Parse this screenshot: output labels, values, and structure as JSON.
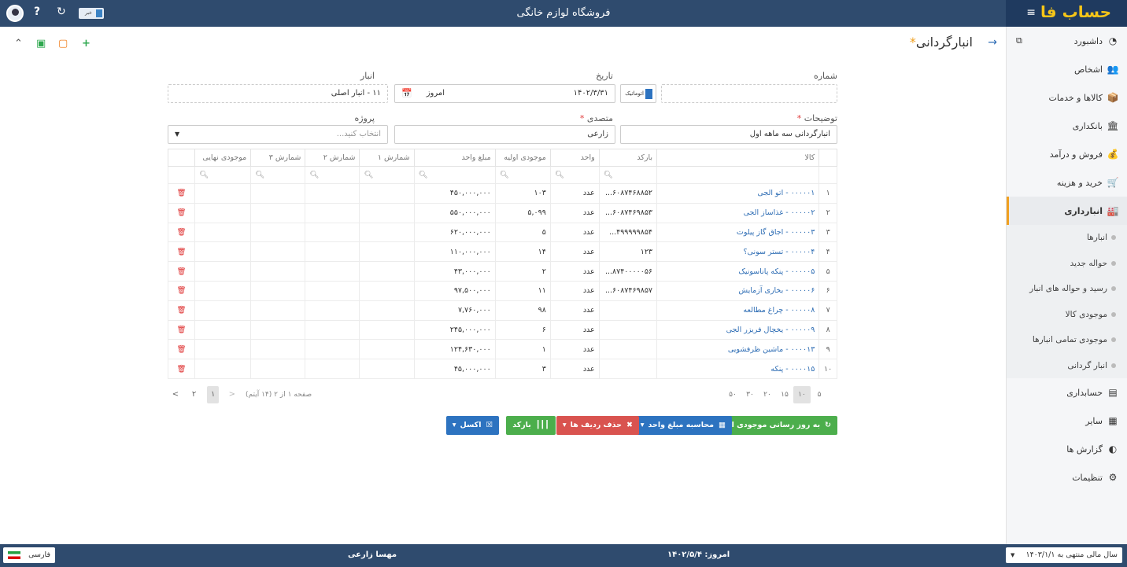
{
  "header": {
    "app_title": "فروشگاه لوازم خانگی",
    "logo": "حساب فا",
    "news_label": "خبر"
  },
  "sidebar": {
    "items": [
      {
        "label": "داشبورد",
        "icon": "dashboard-icon",
        "glyph": "◔"
      },
      {
        "label": "اشخاص",
        "icon": "people-icon",
        "glyph": "👥"
      },
      {
        "label": "کالاها و خدمات",
        "icon": "box-icon",
        "glyph": "📦"
      },
      {
        "label": "بانکداری",
        "icon": "bank-icon",
        "glyph": "🏛"
      },
      {
        "label": "فروش و درآمد",
        "icon": "sales-icon",
        "glyph": "💰"
      },
      {
        "label": "خرید و هزینه",
        "icon": "cart-icon",
        "glyph": "🛒"
      },
      {
        "label": "انبارداری",
        "icon": "warehouse-icon",
        "glyph": "🏭"
      }
    ],
    "sub_items": [
      "انبارها",
      "حواله جدید",
      "رسید و حواله های انبار",
      "موجودی کالا",
      "موجودی تمامی انبارها",
      "انبار گردانی"
    ],
    "bottom_items": [
      {
        "label": "حسابداری",
        "icon": "ledger-icon",
        "glyph": "▤"
      },
      {
        "label": "سایر",
        "icon": "misc-icon",
        "glyph": "▦"
      },
      {
        "label": "گزارش ها",
        "icon": "report-icon",
        "glyph": "◐"
      },
      {
        "label": "تنظیمات",
        "icon": "settings-icon",
        "glyph": "⚙"
      }
    ]
  },
  "page": {
    "title": "انبارگردانی",
    "title_marker": "*"
  },
  "form": {
    "number_label": "شماره",
    "date_label": "تاریخ",
    "auto_label": "اتوماتیک",
    "date_value": "۱۴۰۲/۳/۳۱",
    "today_label": "امروز",
    "warehouse_label": "انبار",
    "warehouse_value": "۱۱ - انبار اصلی",
    "desc_label": "توضیحات",
    "desc_value": "انبارگردانی سه ماهه اول",
    "agent_label": "متصدی",
    "agent_value": "زارعی",
    "project_label": "پروژه",
    "project_placeholder": "انتخاب کنید..."
  },
  "table": {
    "columns": [
      "کالا",
      "بارکد",
      "واحد",
      "موجودی اولیه",
      "مبلغ واحد",
      "شمارش ۱",
      "شمارش ۲",
      "شمارش ۳",
      "موجودی نهایی"
    ],
    "rows": [
      {
        "idx": "۱",
        "item": "۰۰۰۰۰۱ - اتو الجی",
        "barcode": "...۶۰۸۷۴۶۸۸۵۲",
        "unit": "عدد",
        "initial": "۱۰۳",
        "price": "۴۵۰,۰۰۰,۰۰۰"
      },
      {
        "idx": "۲",
        "item": "۰۰۰۰۰۲ - غذاساز الجی",
        "barcode": "...۶۰۸۷۴۶۹۸۵۳",
        "unit": "عدد",
        "initial": "۵,۰۹۹",
        "price": "۵۵۰,۰۰۰,۰۰۰"
      },
      {
        "idx": "۳",
        "item": "۰۰۰۰۰۳ - اجاق گاز پیلوت",
        "barcode": "...۴۹۹۹۹۹۸۵۴",
        "unit": "عدد",
        "initial": "۵",
        "price": "۶۲۰,۰۰۰,۰۰۰"
      },
      {
        "idx": "۴",
        "item": "۰۰۰۰۰۴ - تستر سونی؟",
        "barcode": "۱۲۳",
        "unit": "عدد",
        "initial": "۱۴",
        "price": "۱۱۰,۰۰۰,۰۰۰"
      },
      {
        "idx": "۵",
        "item": "۰۰۰۰۰۵ - پنکه پاناسونیک",
        "barcode": "...۸۷۴۰۰۰۰۰۵۶",
        "unit": "عدد",
        "initial": "۲",
        "price": "۴۳,۰۰۰,۰۰۰"
      },
      {
        "idx": "۶",
        "item": "۰۰۰۰۰۶ - بخاری آزمایش",
        "barcode": "...۶۰۸۷۴۶۹۸۵۷",
        "unit": "عدد",
        "initial": "۱۱",
        "price": "۹۷,۵۰۰,۰۰۰"
      },
      {
        "idx": "۷",
        "item": "۰۰۰۰۰۸ - چراغ مطالعه",
        "barcode": "",
        "unit": "عدد",
        "initial": "۹۸",
        "price": "۷,۷۶۰,۰۰۰"
      },
      {
        "idx": "۸",
        "item": "۰۰۰۰۰۹ - یخچال فریزر الجی",
        "barcode": "",
        "unit": "عدد",
        "initial": "۶",
        "price": "۲۴۵,۰۰۰,۰۰۰"
      },
      {
        "idx": "۹",
        "item": "۰۰۰۰۱۳ - ماشین ظرفشویی",
        "barcode": "",
        "unit": "عدد",
        "initial": "۱",
        "price": "۱۲۴,۶۳۰,۰۰۰"
      },
      {
        "idx": "۱۰",
        "item": "۰۰۰۰۱۵ - پنکه",
        "barcode": "",
        "unit": "عدد",
        "initial": "۳",
        "price": "۴۵,۰۰۰,۰۰۰"
      }
    ]
  },
  "pager": {
    "sizes": [
      "۵",
      "۱۰",
      "۱۵",
      "۲۰",
      "۳۰",
      "۵۰"
    ],
    "active_size": "۱۰",
    "info": "صفحه ۱ از ۲ (۱۴ آیتم)",
    "prev": "<",
    "current": "۱",
    "next_page": "۲",
    "next": ">"
  },
  "buttons": {
    "update_initial": "به روز رسانی موجودی اولیه",
    "calc_price": "محاسبه مبلغ واحد",
    "delete_rows": "حذف ردیف ها",
    "barcode": "بارکد",
    "excel": "اکسل"
  },
  "footer": {
    "fiscal_year": "سال مالی منتهی به ۱۴۰۳/۱/۱",
    "today": "امروز: ۱۴۰۲/۵/۴",
    "user": "مهسا زارعی",
    "language": "فارسی"
  },
  "colors": {
    "topbar": "#2f4b6e",
    "accent": "#f0a020",
    "link": "#2e6db4",
    "danger": "#e03a3a",
    "success": "#4cae4c"
  }
}
